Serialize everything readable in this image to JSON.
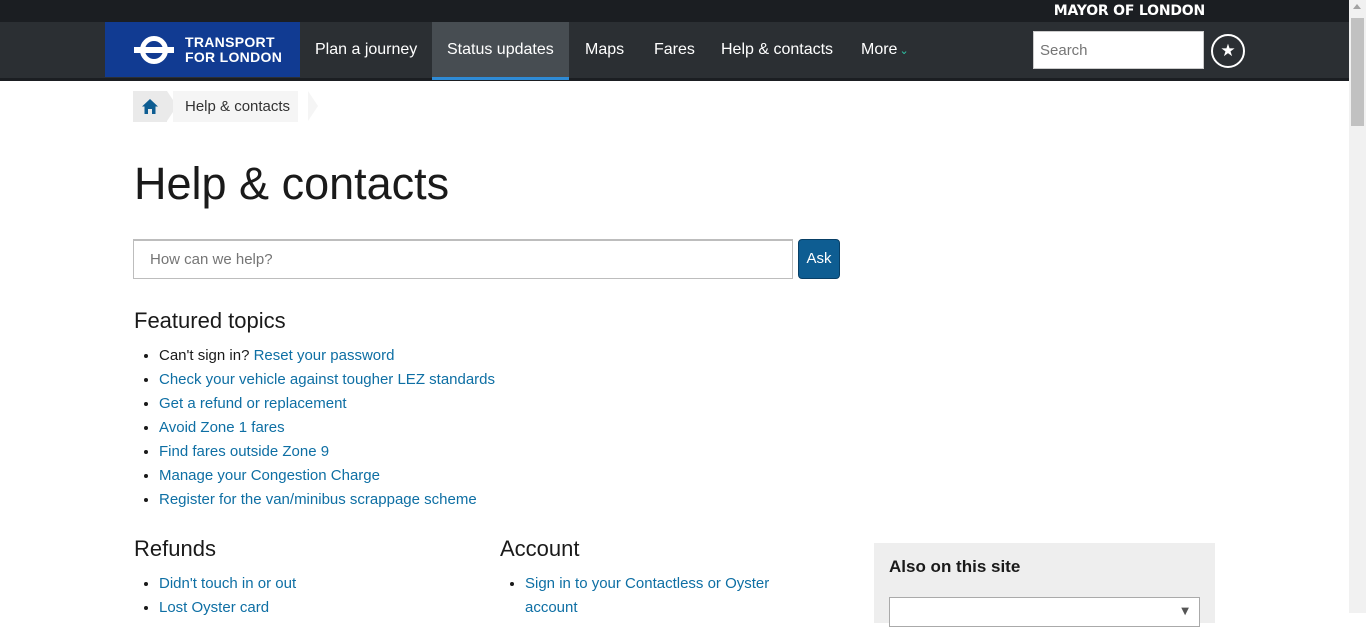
{
  "header": {
    "mayor_label": "MAYOR OF LONDON",
    "logo_line1": "TRANSPORT",
    "logo_line2": "FOR LONDON",
    "nav": [
      {
        "label": "Plan a journey"
      },
      {
        "label": "Status updates",
        "active": true
      },
      {
        "label": "Maps"
      },
      {
        "label": "Fares"
      },
      {
        "label": "Help & contacts"
      },
      {
        "label": "More"
      }
    ],
    "search_placeholder": "Search",
    "favourites_icon": "star-icon"
  },
  "breadcrumb": {
    "home_icon": "home-icon",
    "current": "Help & contacts"
  },
  "page": {
    "title": "Help & contacts",
    "help_search_placeholder": "How can we help?",
    "ask_label": "Ask"
  },
  "featured": {
    "heading": "Featured topics",
    "items": [
      {
        "prefix": "Can't sign in? ",
        "link": "Reset your password"
      },
      {
        "prefix": "",
        "link": "Check your vehicle against tougher LEZ standards"
      },
      {
        "prefix": "",
        "link": "Get a refund or replacement"
      },
      {
        "prefix": "",
        "link": "Avoid Zone 1 fares"
      },
      {
        "prefix": "",
        "link": "Find fares outside Zone 9"
      },
      {
        "prefix": "",
        "link": "Manage your Congestion Charge"
      },
      {
        "prefix": "",
        "link": "Register for the van/minibus scrappage scheme"
      }
    ]
  },
  "refunds": {
    "heading": "Refunds",
    "items": [
      "Didn't touch in or out",
      "Lost Oyster card"
    ]
  },
  "account": {
    "heading": "Account",
    "items": [
      "Sign in to your Contactless or Oyster account"
    ]
  },
  "sidebar": {
    "also_heading": "Also on this site"
  },
  "colors": {
    "nav_bg": "#2b2f33",
    "logo_bg": "#113b92",
    "link": "#0e6fa4",
    "ask_bg": "#0e5d92"
  }
}
